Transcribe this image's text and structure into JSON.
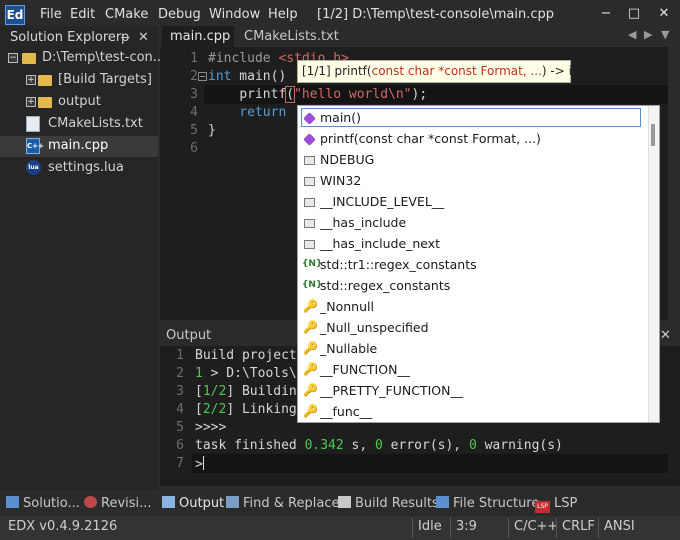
{
  "app": {
    "logo": "Ed",
    "menu": [
      "File",
      "Edit",
      "CMake",
      "Debug",
      "Window",
      "Help"
    ],
    "title": "[1/2] D:\\Temp\\test-console\\main.cpp",
    "controls": {
      "minimize": "−",
      "maximize": "□",
      "close": "✕"
    }
  },
  "sidebar": {
    "title": "Solution Explorer",
    "pin": "ᵽ",
    "close": "✕",
    "items": [
      {
        "label": "D:\\Temp\\test-con...",
        "icon": "folder-icon",
        "expander": "−",
        "selected": false
      },
      {
        "label": "[Build Targets]",
        "icon": "folder-icon",
        "expander": "+",
        "selected": false
      },
      {
        "label": "output",
        "icon": "folder-icon",
        "expander": "+",
        "selected": false
      },
      {
        "label": "CMakeLists.txt",
        "icon": "cmake-file-icon",
        "selected": false
      },
      {
        "label": "main.cpp",
        "icon": "cpp-file-icon",
        "selected": true
      },
      {
        "label": "settings.lua",
        "icon": "lua-file-icon",
        "selected": false
      }
    ]
  },
  "tabs": {
    "main": "main.cpp",
    "cmake": "CMakeLists.txt",
    "nav_left": "◀",
    "nav_right": "▶",
    "nav_down": "▼"
  },
  "editor": {
    "line_numbers": [
      "1",
      "2",
      "3",
      "4",
      "5",
      "6"
    ],
    "fold_markers": [
      "−"
    ],
    "lines": {
      "l1_directive": "#include",
      "l1_header": "<stdio.h>",
      "l2_type": "int",
      "l2_rest": " main()",
      "l3_indent": "    ",
      "l3_func": "printf",
      "l3_open": "(",
      "l3_string": "\"hello world\\n\"",
      "l3_close": ");",
      "l4_kw": "    return",
      "l5": "}"
    }
  },
  "tooltip": {
    "prefix": "[1/1] printf(",
    "params": "const char *const Format, ...",
    "suffix": ") -> int"
  },
  "completion": {
    "items": [
      {
        "label": "main()",
        "kind": "function",
        "selected": true
      },
      {
        "label": "printf(const char *const Format, ...)",
        "kind": "function"
      },
      {
        "label": "NDEBUG",
        "kind": "macro"
      },
      {
        "label": "WIN32",
        "kind": "macro"
      },
      {
        "label": "__INCLUDE_LEVEL__",
        "kind": "macro"
      },
      {
        "label": "__has_include",
        "kind": "macro"
      },
      {
        "label": "__has_include_next",
        "kind": "macro"
      },
      {
        "label": "std::tr1::regex_constants",
        "kind": "namespace"
      },
      {
        "label": "std::regex_constants",
        "kind": "namespace"
      },
      {
        "label": "_Nonnull",
        "kind": "keyword"
      },
      {
        "label": "_Null_unspecified",
        "kind": "keyword"
      },
      {
        "label": "_Nullable",
        "kind": "keyword"
      },
      {
        "label": "__FUNCTION__",
        "kind": "keyword"
      },
      {
        "label": "__PRETTY_FUNCTION__",
        "kind": "keyword"
      },
      {
        "label": "__func__",
        "kind": "keyword"
      }
    ],
    "ns_glyph": "{N}",
    "key_glyph": "🔑"
  },
  "output": {
    "title": "Output",
    "close": "✕",
    "line_numbers": [
      "1",
      "2",
      "3",
      "4",
      "5",
      "6",
      "7"
    ],
    "l1": "Build project",
    "l2_num": "1",
    "l2_rest": " > D:\\Tools\\",
    "l3_open": "[",
    "l3_num": "1/2",
    "l3_rest": "] Buildin",
    "l4_open": "[",
    "l4_num": "2/2",
    "l4_rest": "] Linking",
    "l5": ">>>>",
    "l6_a": "task finished ",
    "l6_time": "0.342",
    "l6_b": " s, ",
    "l6_err": "0",
    "l6_c": " error(s), ",
    "l6_warn": "0",
    "l6_d": " warning(s)",
    "l7": ">"
  },
  "bottom_tabs": {
    "solution": "Solutio...",
    "revisions": "Revisi...",
    "output": "Output",
    "find": "Find & Replace",
    "build": "Build Results",
    "structure": "File Structure",
    "lsp": "LSP",
    "lsp_icon_text": "LSP"
  },
  "status": {
    "version": "EDX v0.4.9.2126",
    "state": "Idle",
    "position": "3:9",
    "language": "C/C++",
    "line_endings": "CRLF",
    "encoding": "ANSI"
  },
  "colors": {
    "keyword": "#569cd6",
    "string": "#d16969",
    "number": "#4ec94e",
    "directive": "#9b9b9b"
  }
}
